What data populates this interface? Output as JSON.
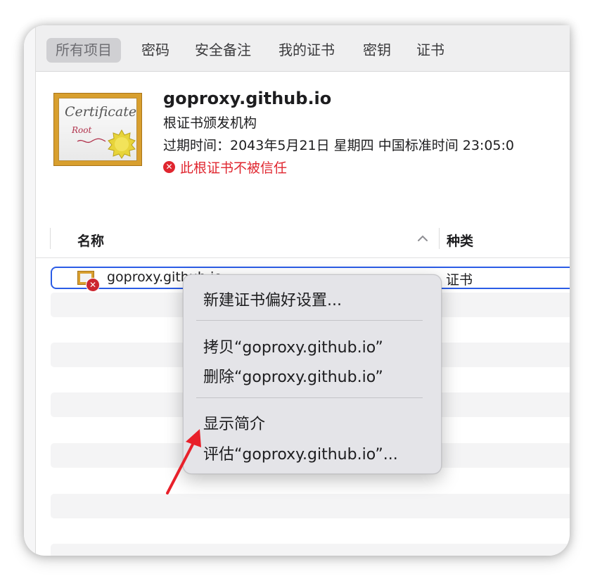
{
  "tabs": [
    {
      "label": "所有项目",
      "active": true
    },
    {
      "label": "密码",
      "active": false
    },
    {
      "label": "安全备注",
      "active": false
    },
    {
      "label": "我的证书",
      "active": false
    },
    {
      "label": "密钥",
      "active": false
    },
    {
      "label": "证书",
      "active": false
    }
  ],
  "certificate": {
    "icon_text_1": "Certificate",
    "icon_text_2": "Root",
    "title": "goproxy.github.io",
    "kind": "根证书颁发机构",
    "expiry": "过期时间：2043年5月21日 星期四 中国标准时间 23:05:0",
    "warning": "此根证书不被信任"
  },
  "columns": {
    "name": "名称",
    "kind": "种类"
  },
  "rows": [
    {
      "name": "goproxy.github.io",
      "kind": "证书",
      "selected": true
    }
  ],
  "context_menu": {
    "items": [
      "新建证书偏好设置...",
      "拷贝“goproxy.github.io”",
      "删除“goproxy.github.io”",
      "显示简介",
      "评估“goproxy.github.io”..."
    ]
  },
  "colors": {
    "accent": "#2b5ce6",
    "error": "#e0262f",
    "annotation_arrow": "#e8202a"
  },
  "icons": [
    "certificate-icon",
    "error-icon",
    "chevron-up-icon",
    "red-arrow-annotation"
  ]
}
